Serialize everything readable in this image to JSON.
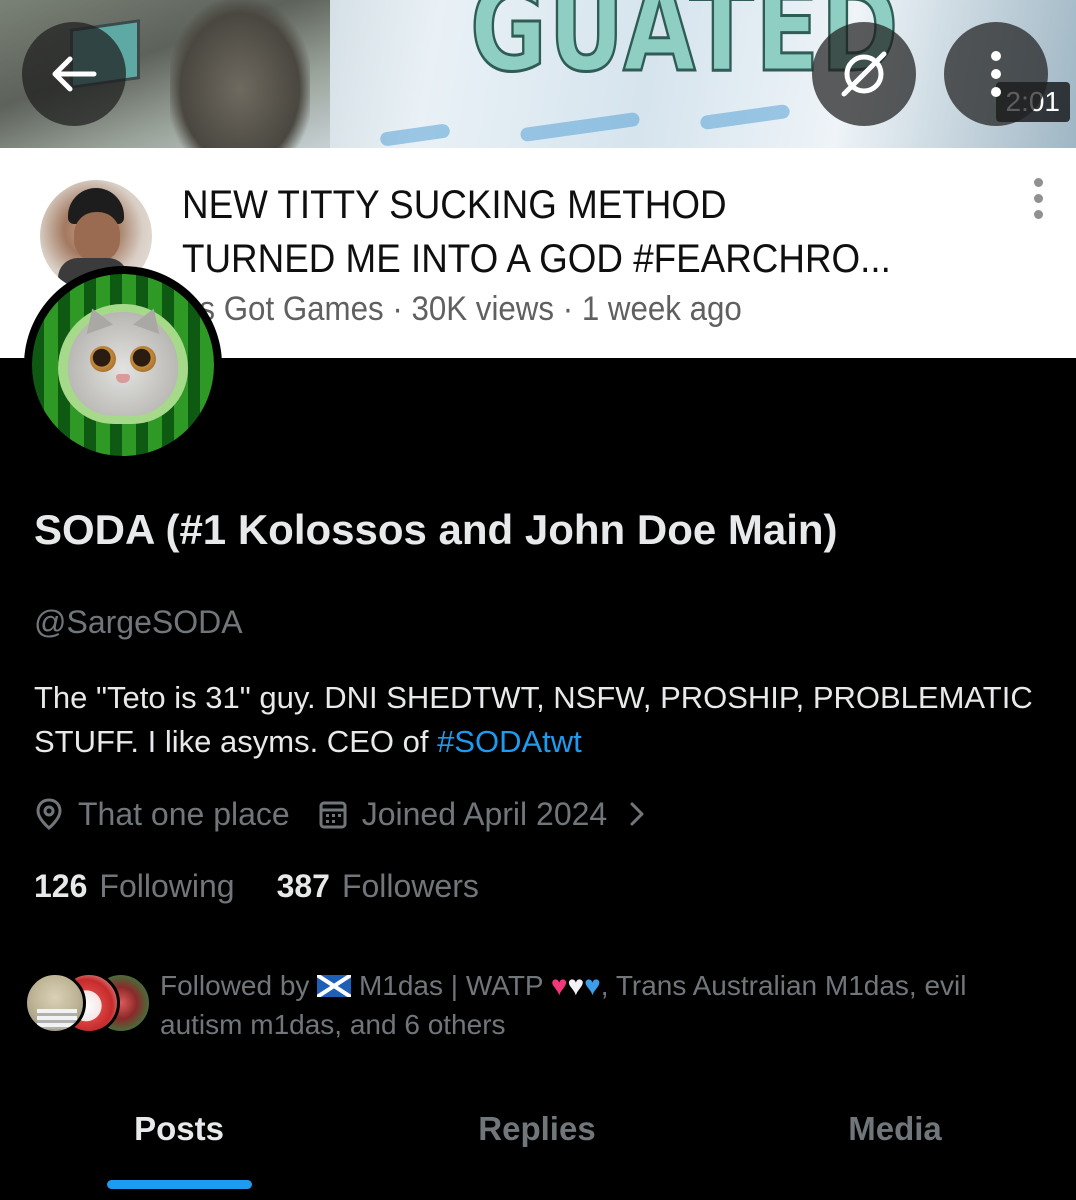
{
  "banner": {
    "thumbnail_headline": "GUATED",
    "duration": "2:01",
    "video_title": "NEW TITTY SUCKING METHOD\nTURNED ME INTO A GOD #FEARCHRO...",
    "video_meta": "us Got Games · 30K views · 1 week ago"
  },
  "toolbar": {
    "back_icon": "arrow-left-icon",
    "grok_icon": "grok-icon",
    "more_icon": "more-vertical-icon"
  },
  "profile": {
    "display_name": "SODA (#1 Kolossos and John Doe Main)",
    "handle": "@SargeSODA",
    "bio_text": "The \"Teto is 31\" guy. DNI SHEDTWT, NSFW, PROSHIP, PROBLEMATIC STUFF. I like asyms. CEO of ",
    "bio_hashtag": "#SODAtwt",
    "location": "That one place",
    "joined": "Joined April 2024",
    "following_count": "126",
    "following_label": "Following",
    "followers_count": "387",
    "followers_label": "Followers",
    "followed_by_prefix": "Followed by ",
    "followed_by_name1": " M1das | WATP ",
    "followed_by_rest": ", Trans Australian M1das, evil autism m1das, and 6 others"
  },
  "tabs": [
    {
      "label": "Posts",
      "active": true
    },
    {
      "label": "Replies",
      "active": false
    },
    {
      "label": "Media",
      "active": false
    }
  ],
  "colors": {
    "accent": "#1d9bf0",
    "background": "#000000",
    "primary_text": "#e7e9ea",
    "secondary_text": "#71767b"
  }
}
